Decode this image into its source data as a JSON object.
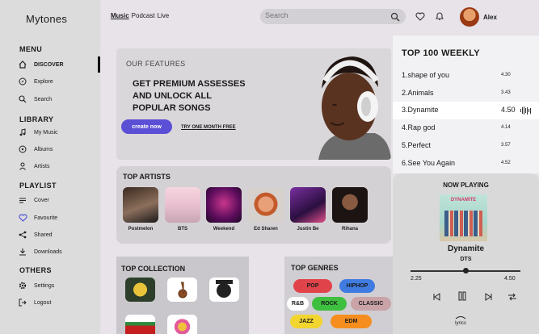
{
  "brand": "Mytones",
  "sidebar": {
    "sections": [
      "MENU",
      "LIBRARY",
      "PLAYLIST",
      "OTHERS"
    ],
    "items": [
      {
        "label": "DISCOVER",
        "icon": "home-icon"
      },
      {
        "label": "Explore",
        "icon": "compass-icon"
      },
      {
        "label": "Search",
        "icon": "search-icon"
      },
      {
        "label": "My Music",
        "icon": "music-note-icon"
      },
      {
        "label": "Albums",
        "icon": "albums-icon"
      },
      {
        "label": "Artists",
        "icon": "person-icon"
      },
      {
        "label": "Cover",
        "icon": "cover-icon"
      },
      {
        "label": "Favourite",
        "icon": "heart-icon"
      },
      {
        "label": "Shared",
        "icon": "share-icon"
      },
      {
        "label": "Downloads",
        "icon": "download-icon"
      },
      {
        "label": "Settings",
        "icon": "gear-icon"
      },
      {
        "label": "Logout",
        "icon": "logout-icon"
      }
    ]
  },
  "header": {
    "tabs": [
      "Music",
      "Podcast",
      "Live"
    ],
    "search_placeholder": "Search",
    "user": "Alex"
  },
  "hero": {
    "features_label": "OUR FEATURES",
    "headline_lines": [
      "GET PREMIUM ASSESSES",
      "AND UNLOCK ALL",
      "POPULAR SONGS"
    ],
    "cta": "create now",
    "trial": "TRY ONE MONTH FREE"
  },
  "top_artists": {
    "title": "TOP ARTISTS",
    "artists": [
      "Postmelon",
      "BTS",
      "Weekend",
      "Ed Sharen",
      "Justin Be",
      "Rihana"
    ]
  },
  "top_collection": {
    "title": "TOP COLLECTION"
  },
  "top_genres": {
    "title": "TOP GENRES",
    "genres": [
      {
        "name": "POP",
        "color": "#e0444a"
      },
      {
        "name": "HIPHOP",
        "color": "#3f7be0"
      },
      {
        "name": "R&B",
        "color": "#ffffff"
      },
      {
        "name": "ROCK",
        "color": "#3fbf3f"
      },
      {
        "name": "CLASSIC",
        "color": "#c9a3a8"
      },
      {
        "name": "JAZZ",
        "color": "#f2d52e"
      },
      {
        "name": "EDM",
        "color": "#f58e1e"
      }
    ]
  },
  "top100": {
    "title": "TOP 100 WEEKLY",
    "rows": [
      {
        "name": "1.shape of you",
        "val": "4.30"
      },
      {
        "name": "2.Animals",
        "val": "3.43"
      },
      {
        "name": "3.Dynamite",
        "val": "4.50"
      },
      {
        "name": "4.Rap god",
        "val": "4.14"
      },
      {
        "name": "5.Perfect",
        "val": "3.57"
      },
      {
        "name": "6.See You Again",
        "val": "4.52"
      }
    ]
  },
  "now_playing": {
    "title": "NOW PLAYING",
    "cover_text": "DYNAMITE",
    "song": "Dynamite",
    "artist": "DTS",
    "elapsed": "2.25",
    "total": "4.50",
    "progress": 0.5,
    "lyrics": "lyrics"
  }
}
